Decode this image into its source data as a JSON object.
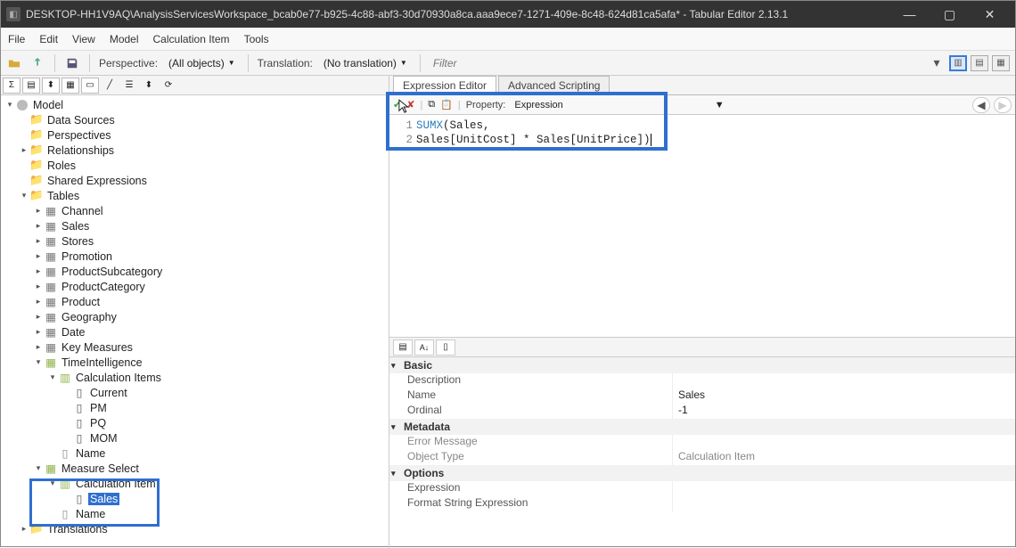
{
  "window": {
    "title": "DESKTOP-HH1V9AQ\\AnalysisServicesWorkspace_bcab0e77-b925-4c88-abf3-30d70930a8ca.aaa9ece7-1271-409e-8c48-624d81ca5afa* - Tabular Editor 2.13.1"
  },
  "menu": {
    "file": "File",
    "edit": "Edit",
    "view": "View",
    "model": "Model",
    "calc_item": "Calculation Item",
    "tools": "Tools"
  },
  "toolbar": {
    "perspective_label": "Perspective:",
    "perspective_value": "(All objects)",
    "translation_label": "Translation:",
    "translation_value": "(No translation)",
    "filter_placeholder": "Filter"
  },
  "tree": {
    "root": "Model",
    "data_sources": "Data Sources",
    "perspectives": "Perspectives",
    "relationships": "Relationships",
    "roles": "Roles",
    "shared_expr": "Shared Expressions",
    "tables": "Tables",
    "tbl_channel": "Channel",
    "tbl_sales": "Sales",
    "tbl_stores": "Stores",
    "tbl_promotion": "Promotion",
    "tbl_prodsub": "ProductSubcategory",
    "tbl_prodcat": "ProductCategory",
    "tbl_product": "Product",
    "tbl_geo": "Geography",
    "tbl_date": "Date",
    "tbl_keymeas": "Key Measures",
    "tbl_timeintel": "TimeIntelligence",
    "calc_items_folder": "Calculation Items",
    "ci_current": "Current",
    "ci_pm": "PM",
    "ci_pq": "PQ",
    "ci_mom": "MOM",
    "col_name": "Name",
    "tbl_measure_select": "Measure Select",
    "calc_item_folder2": "Calculation Item",
    "ci_sales": "Sales",
    "col_name2": "Name",
    "translations": "Translations"
  },
  "right": {
    "tab_expr": "Expression Editor",
    "tab_script": "Advanced Scripting",
    "property_label": "Property:",
    "property_value": "Expression",
    "code_line1_a": "SUMX",
    "code_line1_b": "(Sales,",
    "code_line2": "Sales[UnitCost] * Sales[UnitPrice])",
    "gutter1": "1",
    "gutter2": "2"
  },
  "props": {
    "cat_basic": "Basic",
    "p_desc": "Description",
    "p_name": "Name",
    "p_name_v": "Sales",
    "p_ordinal": "Ordinal",
    "p_ordinal_v": "-1",
    "cat_meta": "Metadata",
    "p_error": "Error Message",
    "p_objtype": "Object Type",
    "p_objtype_v": "Calculation Item",
    "cat_options": "Options",
    "p_expr": "Expression",
    "p_fse": "Format String Expression"
  }
}
